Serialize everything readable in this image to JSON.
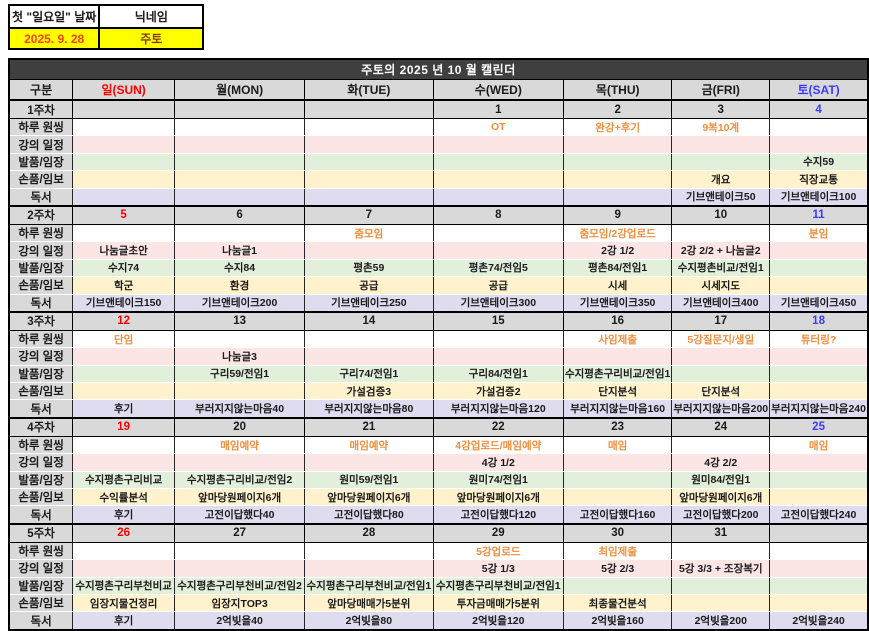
{
  "info_table": {
    "headers": [
      "첫 \"일요일\" 날짜",
      "닉네임"
    ],
    "values": [
      "2025. 9. 28",
      "주토"
    ]
  },
  "calendar": {
    "title": "주토의 2025 년 10 월 캘린더",
    "column_headers": [
      "구분",
      "일(SUN)",
      "월(MON)",
      "화(TUE)",
      "수(WED)",
      "목(THU)",
      "금(FRI)",
      "토(SAT)"
    ],
    "row_labels": [
      "하루 원씽",
      "강의 일정",
      "발품/임장",
      "손품/임보",
      "독서"
    ],
    "weeks": [
      {
        "label": "1주차",
        "dates": [
          "",
          "",
          "",
          "1",
          "2",
          "3",
          "4"
        ],
        "rows": [
          [
            "",
            "",
            "",
            "OT",
            "완강+후기",
            "9복10계",
            ""
          ],
          [
            "",
            "",
            "",
            "",
            "",
            "",
            ""
          ],
          [
            "",
            "",
            "",
            "",
            "",
            "",
            "수지59"
          ],
          [
            "",
            "",
            "",
            "",
            "",
            "개요",
            "직장교통"
          ],
          [
            "",
            "",
            "",
            "",
            "",
            "기브앤테이크50",
            "기브앤테이크100"
          ]
        ]
      },
      {
        "label": "2주차",
        "dates": [
          "5",
          "6",
          "7",
          "8",
          "9",
          "10",
          "11"
        ],
        "rows": [
          [
            "",
            "",
            "줌모임",
            "",
            "줌모임/2강업로드",
            "",
            "분임"
          ],
          [
            "나눔글초안",
            "나눔글1",
            "",
            "",
            "2강 1/2",
            "2강 2/2 + 나눔글2",
            ""
          ],
          [
            "수지74",
            "수지84",
            "평촌59",
            "평촌74/전임5",
            "평촌84/전임1",
            "수지평촌비교/전임1",
            ""
          ],
          [
            "학군",
            "환경",
            "공급",
            "공급",
            "시세",
            "시세지도",
            ""
          ],
          [
            "기브앤테이크150",
            "기브앤테이크200",
            "기브앤테이크250",
            "기브앤테이크300",
            "기브앤테이크350",
            "기브앤테이크400",
            "기브앤테이크450"
          ]
        ]
      },
      {
        "label": "3주차",
        "dates": [
          "12",
          "13",
          "14",
          "15",
          "16",
          "17",
          "18"
        ],
        "rows": [
          [
            "단임",
            "",
            "",
            "",
            "사임제출",
            "5강질문지/생일",
            "튜터링?"
          ],
          [
            "",
            "나눔글3",
            "",
            "",
            "",
            "",
            ""
          ],
          [
            "",
            "구리59/전임1",
            "구리74/전임1",
            "구리84/전임1",
            "수지평촌구리비교/전임1",
            "",
            ""
          ],
          [
            "",
            "",
            "가설검증3",
            "가설검증2",
            "단지분석",
            "단지분석",
            ""
          ],
          [
            "후기",
            "부러지지않는마음40",
            "부러지지않는마음80",
            "부러지지않는마음120",
            "부러지지않는마음160",
            "부러지지않는마음200",
            "부러지지않는마음240"
          ]
        ]
      },
      {
        "label": "4주차",
        "dates": [
          "19",
          "20",
          "21",
          "22",
          "23",
          "24",
          "25"
        ],
        "rows": [
          [
            "",
            "매임예약",
            "매임예약",
            "4강업로드/매임예약",
            "매임",
            "",
            "매임"
          ],
          [
            "",
            "",
            "",
            "4강 1/2",
            "",
            "4강 2/2",
            ""
          ],
          [
            "수지평촌구리비교",
            "수지평촌구리비교/전임2",
            "원미59/전임1",
            "원미74/전임1",
            "",
            "원미84/전임1",
            ""
          ],
          [
            "수익률분석",
            "앞마당원페이지6개",
            "앞마당원페이지6개",
            "앞마당원페이지6개",
            "",
            "앞마당원페이지6개",
            ""
          ],
          [
            "후기",
            "고전이답했다40",
            "고전이답했다80",
            "고전이답했다120",
            "고전이답했다160",
            "고전이답했다200",
            "고전이답했다240"
          ]
        ]
      },
      {
        "label": "5주차",
        "dates": [
          "26",
          "27",
          "28",
          "29",
          "30",
          "31",
          ""
        ],
        "rows": [
          [
            "",
            "",
            "",
            "5강업로드",
            "최임제출",
            "",
            ""
          ],
          [
            "",
            "",
            "",
            "5강 1/3",
            "5강 2/3",
            "5강 3/3 + 조장복기",
            ""
          ],
          [
            "수지평촌구리부천비교",
            "수지평촌구리부천비교/전임2",
            "수지평촌구리부천비교/전임1",
            "수지평촌구리부천비교/전임1",
            "",
            "",
            ""
          ],
          [
            "임장지물건정리",
            "임장지TOP3",
            "앞마당매매가5분위",
            "투자금매매가5분위",
            "최종물건분석",
            "",
            ""
          ],
          [
            "후기",
            "2억빚을40",
            "2억빚을80",
            "2억빚을120",
            "2억빚을160",
            "2억빚을200",
            "2억빚을240"
          ]
        ]
      }
    ]
  },
  "colors": {
    "header_gray": "#d9d9d9",
    "title_bar": "#3f3f3f",
    "accent_orange": "#ee8f3e",
    "sunday_red": "#ff0000",
    "saturday_blue": "#3b3bff",
    "highlight_yellow": "#ffff00",
    "row_pink": "#fbe5e5",
    "row_green": "#e2efda",
    "row_yellow": "#fff2cc",
    "row_purple": "#e0dcf0"
  }
}
